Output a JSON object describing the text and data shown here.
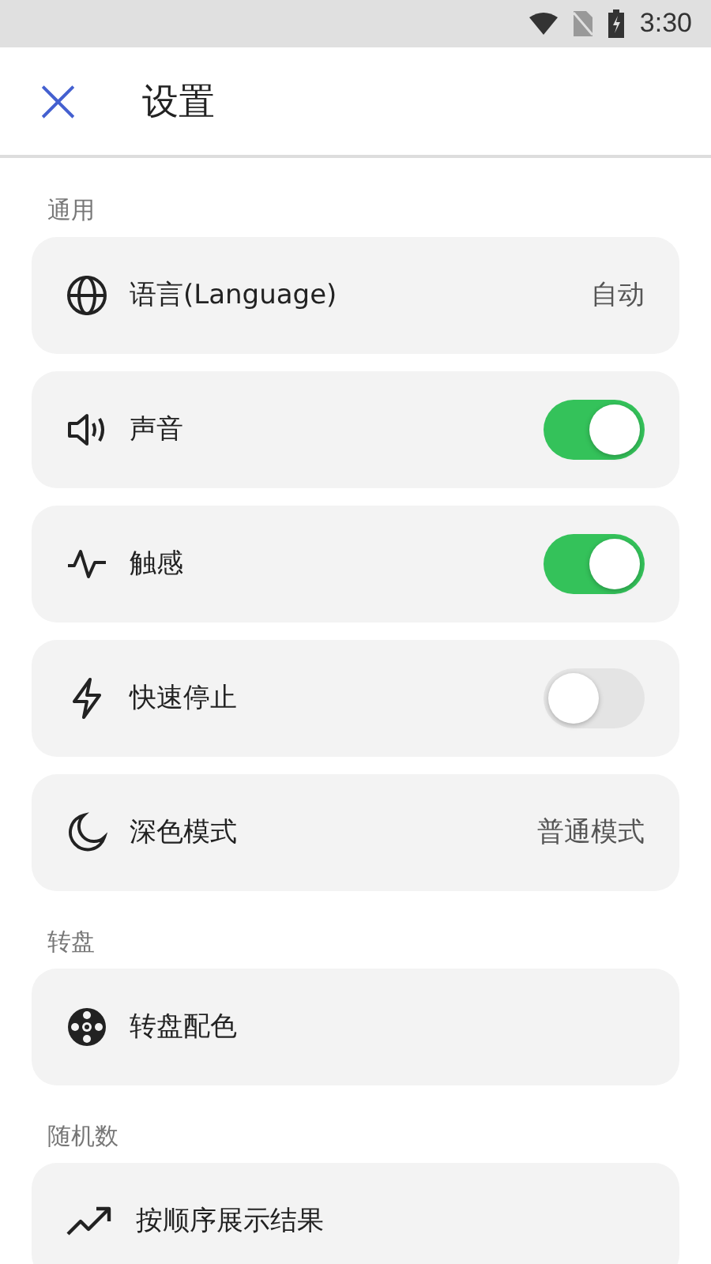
{
  "status_bar": {
    "time": "3:30"
  },
  "header": {
    "close": "×",
    "title": "设置"
  },
  "sections": [
    {
      "label": "通用",
      "items": [
        {
          "kind": "value",
          "label": "语言(Language)",
          "value": "自动"
        },
        {
          "kind": "toggle",
          "label": "声音",
          "on": true
        },
        {
          "kind": "toggle",
          "label": "触感",
          "on": true
        },
        {
          "kind": "toggle",
          "label": "快速停止",
          "on": false
        },
        {
          "kind": "value",
          "label": "深色模式",
          "value": "普通模式"
        }
      ]
    },
    {
      "label": "转盘",
      "items": [
        {
          "kind": "link",
          "label": "转盘配色"
        }
      ]
    },
    {
      "label": "随机数",
      "items": [
        {
          "kind": "link",
          "label": "按顺序展示结果"
        }
      ]
    }
  ]
}
